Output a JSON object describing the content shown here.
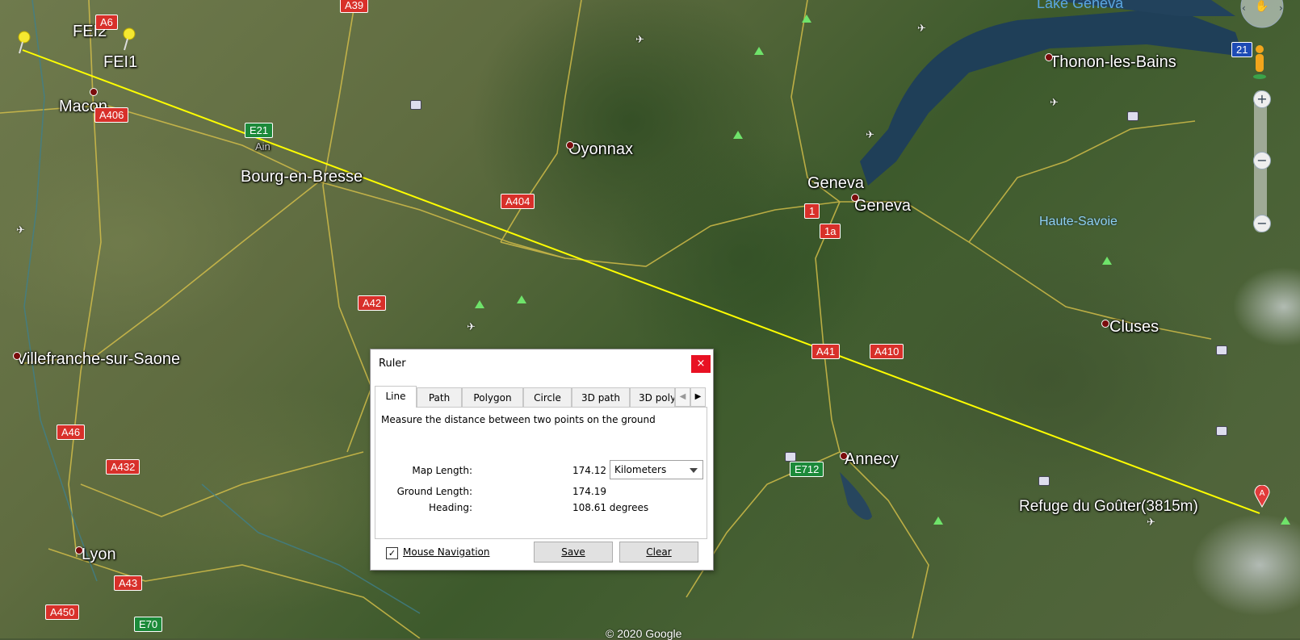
{
  "app": {
    "window": "Google Earth"
  },
  "map": {
    "places": [
      {
        "name": "FEI2"
      },
      {
        "name": "FEI1"
      },
      {
        "name": "Macon"
      },
      {
        "name": "Oyonnax"
      },
      {
        "name": "Bourg-en-Bresse"
      },
      {
        "name": "Ain"
      },
      {
        "name": "Geneva"
      },
      {
        "name": "Geneva"
      },
      {
        "name": "Thonon-les-Bains"
      },
      {
        "name": "Lake Geneva"
      },
      {
        "name": "Haute-Savoie"
      },
      {
        "name": "Cluses"
      },
      {
        "name": "Villefranche-sur-Saone"
      },
      {
        "name": "Annecy"
      },
      {
        "name": "Lyon"
      },
      {
        "name": "Refuge du Goûter(3815m)"
      }
    ],
    "roads": [
      "A6",
      "A39",
      "A406",
      "E21",
      "A404",
      "A42",
      "A41",
      "A410",
      "A46",
      "A432",
      "E712",
      "A43",
      "A450",
      "E70",
      "1",
      "1a",
      "21"
    ],
    "copyright": "© 2020 Google",
    "ruler_line_color": "#ffff00"
  },
  "nav": {
    "zoom_in": "+",
    "zoom_out": "−",
    "zoom_mid": "−"
  },
  "ruler": {
    "title": "Ruler",
    "close": "×",
    "tabs": [
      "Line",
      "Path",
      "Polygon",
      "Circle",
      "3D path",
      "3D poly"
    ],
    "active_tab": "Line",
    "tab_left": "◀",
    "tab_right": "▶",
    "description": "Measure the distance between two points on the ground",
    "map_length_label": "Map Length:",
    "map_length_value": "174.12",
    "unit": "Kilometers",
    "ground_length_label": "Ground Length:",
    "ground_length_value": "174.19",
    "heading_label": "Heading:",
    "heading_value": "108.61 degrees",
    "mouse_nav_label": "Mouse Navigation",
    "mouse_nav_checked": "✓",
    "save_label": "Save",
    "clear_label": "Clear"
  }
}
